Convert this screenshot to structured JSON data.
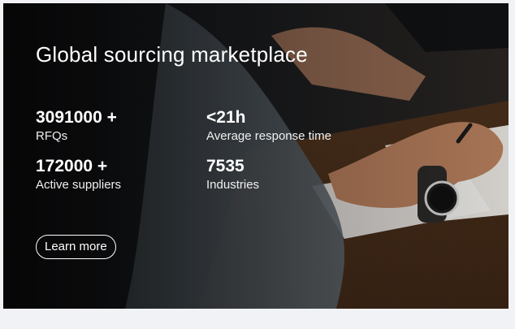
{
  "hero": {
    "title": "Global sourcing marketplace",
    "stats": [
      {
        "value": "3091000 +",
        "label": "RFQs"
      },
      {
        "value": "<21h",
        "label": "Average response time"
      },
      {
        "value": "172000 +",
        "label": "Active suppliers"
      },
      {
        "value": "7535",
        "label": "Industries"
      }
    ],
    "button_label": "Learn more"
  },
  "colors": {
    "page_background": "#f1f2f6",
    "overlay_dark": "#121212",
    "text": "#ffffff"
  }
}
